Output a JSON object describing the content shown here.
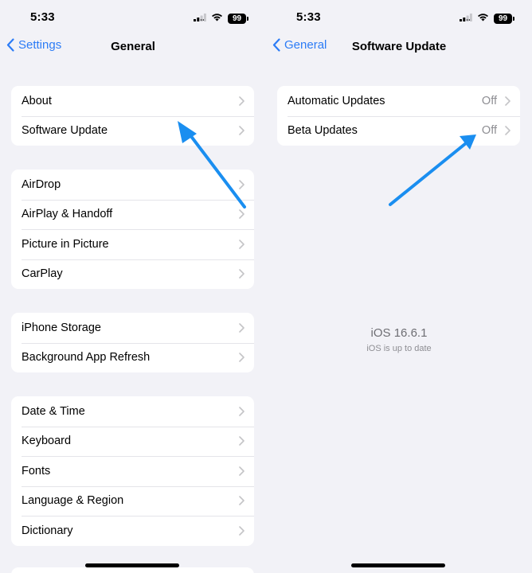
{
  "status_bar": {
    "time": "5:33",
    "battery": "99"
  },
  "left": {
    "nav": {
      "back_label": "Settings",
      "title": "General"
    },
    "groups": [
      {
        "items": [
          {
            "label": "About"
          },
          {
            "label": "Software Update"
          }
        ]
      },
      {
        "items": [
          {
            "label": "AirDrop"
          },
          {
            "label": "AirPlay & Handoff"
          },
          {
            "label": "Picture in Picture"
          },
          {
            "label": "CarPlay"
          }
        ]
      },
      {
        "items": [
          {
            "label": "iPhone Storage"
          },
          {
            "label": "Background App Refresh"
          }
        ]
      },
      {
        "items": [
          {
            "label": "Date & Time"
          },
          {
            "label": "Keyboard"
          },
          {
            "label": "Fonts"
          },
          {
            "label": "Language & Region"
          },
          {
            "label": "Dictionary"
          }
        ]
      }
    ]
  },
  "right": {
    "nav": {
      "back_label": "General",
      "title": "Software Update"
    },
    "items": [
      {
        "label": "Automatic Updates",
        "value": "Off"
      },
      {
        "label": "Beta Updates",
        "value": "Off"
      }
    ],
    "version": "iOS 16.6.1",
    "version_status": "iOS is up to date"
  },
  "icons": [
    "chevron-left-icon",
    "chevron-right-icon",
    "cellular-signal-icon",
    "wifi-icon",
    "battery-icon",
    "annotation-arrow-icon"
  ],
  "colors": {
    "accent": "#2c7cf6",
    "background": "#f2f2f7",
    "secondary_text": "#8e8e93",
    "annotation_arrow": "#1a8ef0"
  }
}
